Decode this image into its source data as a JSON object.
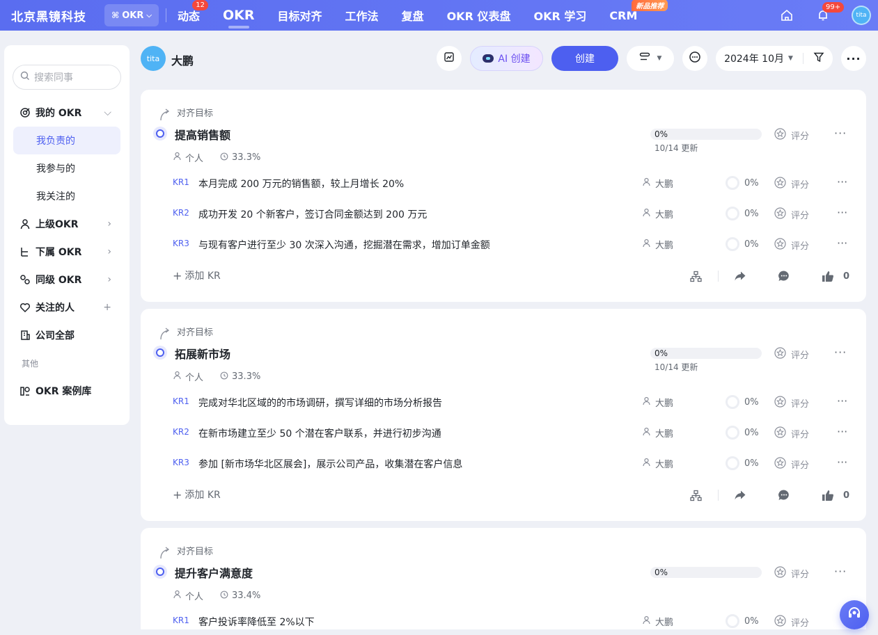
{
  "brand": "北京黑镜科技",
  "app_switch": "OKR",
  "nav": [
    {
      "label": "动态",
      "badge": "12"
    },
    {
      "label": "OKR"
    },
    {
      "label": "目标对齐"
    },
    {
      "label": "工作法"
    },
    {
      "label": "复盘"
    },
    {
      "label": "OKR 仪表盘"
    },
    {
      "label": "OKR 学习"
    },
    {
      "label": "CRM",
      "tag": "新品推荐"
    }
  ],
  "notifications_badge": "99+",
  "avatar_text": "tita",
  "sidebar": {
    "search_placeholder": "搜索同事",
    "my_okr": "我的 OKR",
    "sub_items": [
      "我负责的",
      "我参与的",
      "我关注的"
    ],
    "items": [
      "上级OKR",
      "下属 OKR",
      "同级 OKR",
      "关注的人",
      "公司全部"
    ],
    "group_label": "其他",
    "case_library": "OKR 案例库"
  },
  "header": {
    "user_name": "大鹏",
    "ai_create": "AI 创建",
    "create": "创建",
    "date": "2024年 10月"
  },
  "objectives": [
    {
      "align_label": "对齐目标",
      "title": "提高销售额",
      "type": "个人",
      "weight": "33.3%",
      "progress": "0%",
      "progress_value": 0,
      "updated": "10/14 更新",
      "rate": "评分",
      "add_kr": "添加 KR",
      "likes": "0",
      "krs": [
        {
          "code": "KR1",
          "text": "本月完成 200 万元的销售额，较上月增长 20%",
          "owner": "大鹏",
          "progress": "0%",
          "rate": "评分"
        },
        {
          "code": "KR2",
          "text": "成功开发 20 个新客户，签订合同金额达到 200 万元",
          "owner": "大鹏",
          "progress": "0%",
          "rate": "评分"
        },
        {
          "code": "KR3",
          "text": "与现有客户进行至少 30 次深入沟通，挖掘潜在需求，增加订单金额",
          "owner": "大鹏",
          "progress": "0%",
          "rate": "评分"
        }
      ]
    },
    {
      "align_label": "对齐目标",
      "title": "拓展新市场",
      "type": "个人",
      "weight": "33.3%",
      "progress": "0%",
      "progress_value": 0,
      "updated": "10/14 更新",
      "rate": "评分",
      "add_kr": "添加 KR",
      "likes": "0",
      "krs": [
        {
          "code": "KR1",
          "text": "完成对华北区域的的市场调研，撰写详细的市场分析报告",
          "owner": "大鹏",
          "progress": "0%",
          "rate": "评分"
        },
        {
          "code": "KR2",
          "text": "在新市场建立至少 50 个潜在客户联系，并进行初步沟通",
          "owner": "大鹏",
          "progress": "0%",
          "rate": "评分"
        },
        {
          "code": "KR3",
          "text": "参加 [新市场华北区展会]，展示公司产品，收集潜在客户信息",
          "owner": "大鹏",
          "progress": "0%",
          "rate": "评分"
        }
      ]
    },
    {
      "align_label": "对齐目标",
      "title": "提升客户满意度",
      "type": "个人",
      "weight": "33.4%",
      "progress": "0%",
      "progress_value": 0,
      "rate": "评分",
      "krs": [
        {
          "code": "KR1",
          "text": "客户投诉率降低至 2%以下",
          "owner": "大鹏",
          "progress": "0%",
          "rate": "评分"
        }
      ]
    }
  ]
}
